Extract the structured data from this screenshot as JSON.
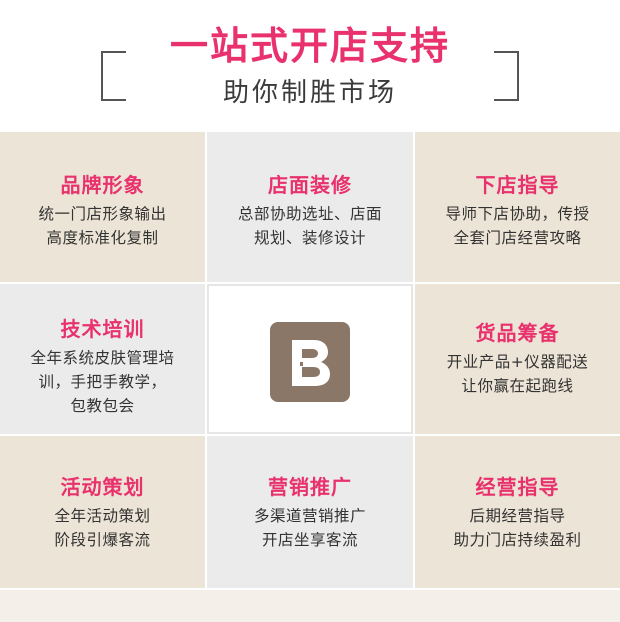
{
  "header": {
    "title": "一站式开店支持",
    "subtitle": "助你制胜市场"
  },
  "cells": [
    {
      "title": "品牌形象",
      "text": "统一门店形象输出\n高度标准化复制"
    },
    {
      "title": "店面装修",
      "text": "总部协助选址、店面\n规划、装修设计"
    },
    {
      "title": "下店指导",
      "text": "导师下店协助，传授\n全套门店经营攻略"
    },
    {
      "title": "技术培训",
      "text": "全年系统皮肤管理培\n训，手把手教学，\n包教包会"
    },
    {
      "title": "货品筹备",
      "text": "开业产品+仪器配送\n让你赢在起跑线"
    },
    {
      "title": "活动策划",
      "text": "全年活动策划\n阶段引爆客流"
    },
    {
      "title": "营销推广",
      "text": "多渠道营销推广\n开店坐享客流"
    },
    {
      "title": "经营指导",
      "text": "后期经营指导\n助力门店持续盈利"
    }
  ],
  "logo": {
    "icon": "brand-b-logo-icon",
    "color": "#8a7768"
  },
  "colors": {
    "accent": "#e8316d",
    "beige": "#ece4d6",
    "gray": "#ebebeb"
  }
}
